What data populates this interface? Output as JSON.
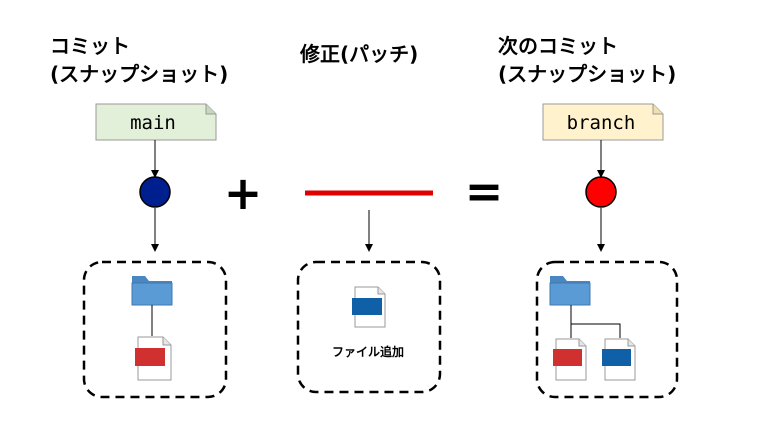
{
  "headings": {
    "commit_line1": "コミット",
    "commit_line2": "(スナップショット)",
    "patch": "修正(パッチ)",
    "next_line1": "次のコミット",
    "next_line2": "(スナップショット)"
  },
  "tags": {
    "main": "main",
    "branch": "branch"
  },
  "operators": {
    "plus": "+",
    "equals": "="
  },
  "patch_box": {
    "label": "ファイル追加"
  },
  "colors": {
    "main_tag_fill": "#e2efd9",
    "branch_tag_fill": "#fff2cc",
    "commit_main": "#001f8f",
    "commit_branch": "#ff0000",
    "patch_line": "#e00000",
    "folder": "#5b9bd5",
    "file_red": "#d03030",
    "file_blue": "#1060a8"
  }
}
